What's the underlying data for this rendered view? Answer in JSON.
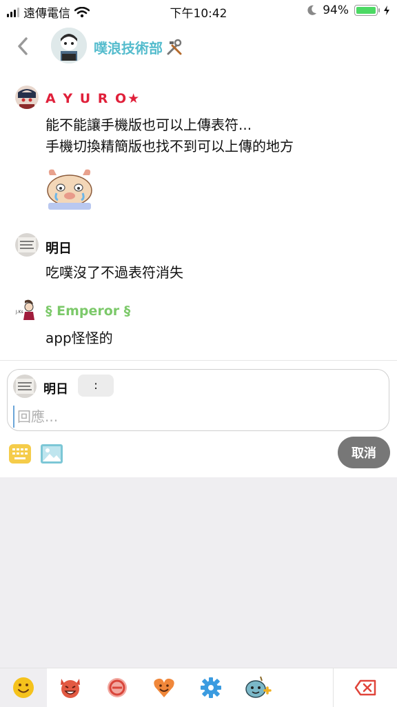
{
  "status_bar": {
    "carrier": "遠傳電信",
    "time": "下午10:42",
    "battery": "94%",
    "battery_level": 0.94
  },
  "header": {
    "back_icon": "chevron-left-icon",
    "title": "噗浪技術部",
    "title_emoji": "🛠"
  },
  "responses": [
    {
      "name": "A Y U R O★",
      "name_color": "#e0203a",
      "lines": [
        "能不能讓手機版也可以上傳表符...",
        "手機切換精簡版也找不到可以上傳的地方"
      ],
      "has_sticker": true
    },
    {
      "name": "明日",
      "name_color": "#111111",
      "lines": [
        "吃噗沒了不過表符消失"
      ]
    },
    {
      "name": "§ Emperor §",
      "name_color": "#7cc96a",
      "lines": [
        "app怪怪的"
      ]
    }
  ],
  "reply": {
    "name": "明日",
    "qualifier": ":",
    "placeholder": "回應...",
    "value": "",
    "cancel_label": "取消"
  },
  "emoji_tabs": [
    "smile-icon",
    "devil-icon",
    "ban-icon",
    "heart-face-icon",
    "gear-icon",
    "custom-emoticon-icon",
    "backspace-icon"
  ],
  "colors": {
    "accent": "#55bccd",
    "cancel_bg": "#777777"
  }
}
